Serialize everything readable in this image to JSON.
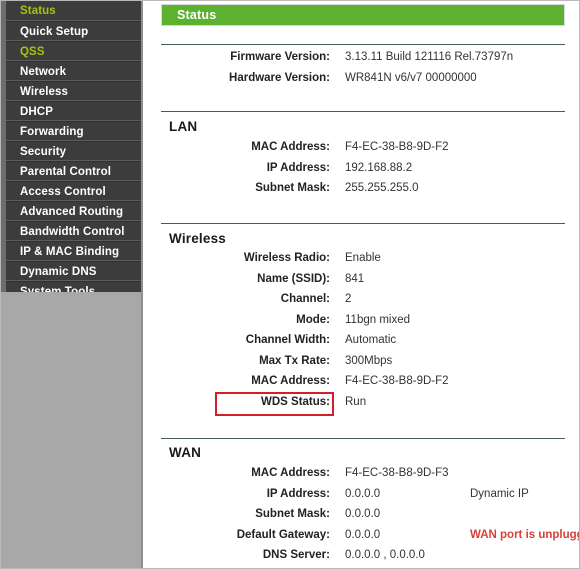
{
  "sidebar": {
    "items": [
      {
        "label": "Status",
        "active": true
      },
      {
        "label": "Quick Setup",
        "active": false
      },
      {
        "label": "QSS",
        "active": true
      },
      {
        "label": "Network",
        "active": false
      },
      {
        "label": "Wireless",
        "active": false
      },
      {
        "label": "DHCP",
        "active": false
      },
      {
        "label": "Forwarding",
        "active": false
      },
      {
        "label": "Security",
        "active": false
      },
      {
        "label": "Parental Control",
        "active": false
      },
      {
        "label": "Access Control",
        "active": false
      },
      {
        "label": "Advanced Routing",
        "active": false
      },
      {
        "label": "Bandwidth Control",
        "active": false
      },
      {
        "label": "IP & MAC Binding",
        "active": false
      },
      {
        "label": "Dynamic DNS",
        "active": false
      },
      {
        "label": "System Tools",
        "active": false
      }
    ]
  },
  "header": {
    "title": "Status"
  },
  "device": {
    "rows": [
      {
        "label": "Firmware Version:",
        "value": "3.13.11 Build 121116 Rel.73797n"
      },
      {
        "label": "Hardware Version:",
        "value": "WR841N v6/v7 00000000"
      }
    ]
  },
  "lan": {
    "heading": "LAN",
    "rows": [
      {
        "label": "MAC Address:",
        "value": "F4-EC-38-B8-9D-F2"
      },
      {
        "label": "IP Address:",
        "value": "192.168.88.2"
      },
      {
        "label": "Subnet Mask:",
        "value": "255.255.255.0"
      }
    ]
  },
  "wireless": {
    "heading": "Wireless",
    "rows": [
      {
        "label": "Wireless Radio:",
        "value": "Enable"
      },
      {
        "label": "Name (SSID):",
        "value": "841"
      },
      {
        "label": "Channel:",
        "value": "2"
      },
      {
        "label": "Mode:",
        "value": "11bgn mixed"
      },
      {
        "label": "Channel Width:",
        "value": "Automatic"
      },
      {
        "label": "Max Tx Rate:",
        "value": "300Mbps"
      },
      {
        "label": "MAC Address:",
        "value": "F4-EC-38-B8-9D-F2"
      },
      {
        "label": "WDS Status:",
        "value": "Run"
      }
    ]
  },
  "wan": {
    "heading": "WAN",
    "rows": [
      {
        "label": "MAC Address:",
        "value": "F4-EC-38-B8-9D-F3",
        "extra": ""
      },
      {
        "label": "IP Address:",
        "value": "0.0.0.0",
        "extra": "Dynamic IP"
      },
      {
        "label": "Subnet Mask:",
        "value": "0.0.0.0",
        "extra": ""
      },
      {
        "label": "Default Gateway:",
        "value": "0.0.0.0",
        "extra": "WAN port is unplugged!"
      },
      {
        "label": "DNS Server:",
        "value": "0.0.0.0 , 0.0.0.0",
        "extra": ""
      }
    ]
  },
  "colors": {
    "header_green": "#5cb130",
    "menu_active": "#a9c116",
    "annotation_red": "#d2202a",
    "warning_red": "#d8403a",
    "sidebar_dark": "#3c3c3c",
    "sidebar_gray": "#a8a8a8"
  }
}
